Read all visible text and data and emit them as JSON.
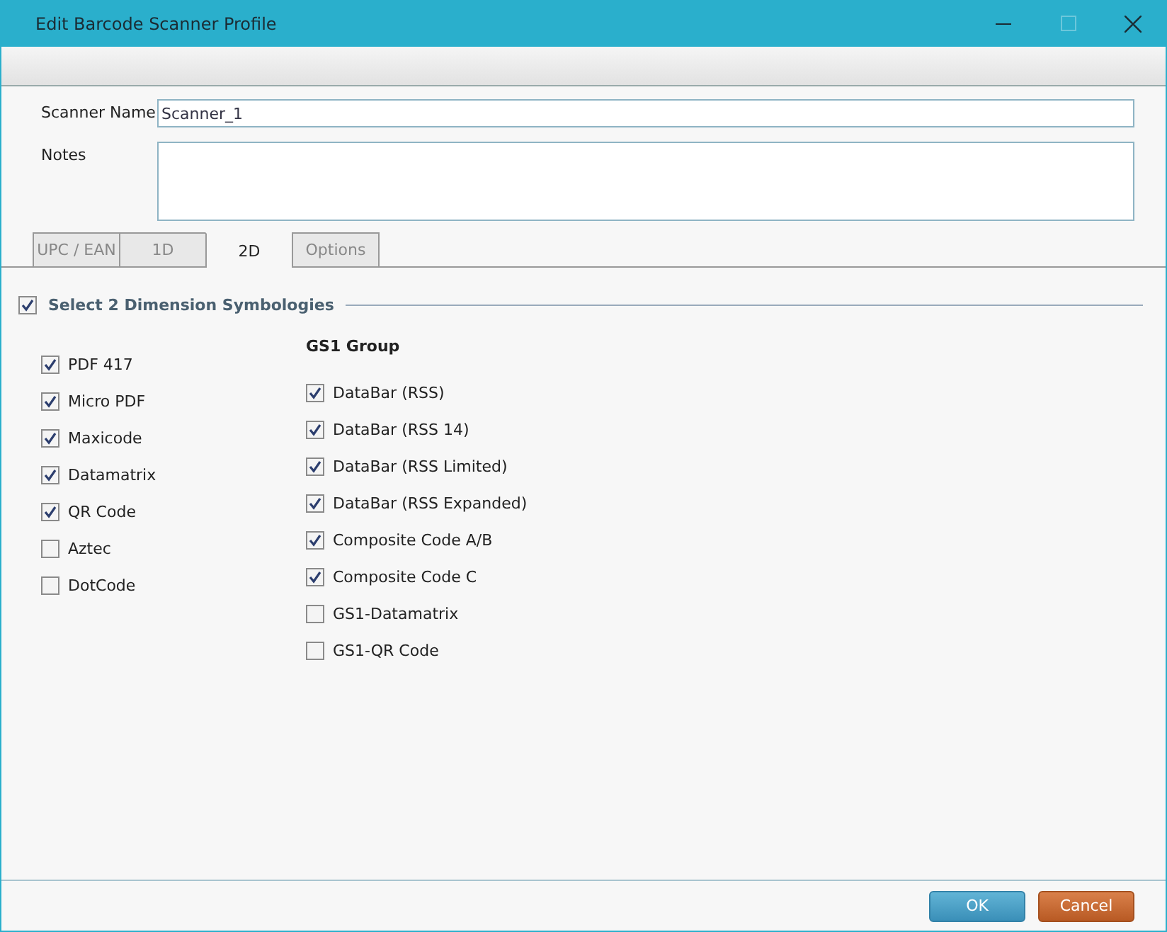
{
  "window": {
    "title": "Edit Barcode Scanner Profile"
  },
  "form": {
    "scanner_name": {
      "label": "Scanner Name",
      "value": "Scanner_1"
    },
    "notes": {
      "label": "Notes"
    }
  },
  "tabs": [
    {
      "label": "UPC / EAN",
      "selected": false
    },
    {
      "label": "1D",
      "selected": false
    },
    {
      "label": "2D",
      "selected": true
    },
    {
      "label": "Options",
      "selected": false
    }
  ],
  "group": {
    "label": "Select 2 Dimension Symbologies",
    "checked": true
  },
  "symbologies": [
    {
      "label": "PDF 417",
      "checked": true
    },
    {
      "label": "Micro PDF",
      "checked": true
    },
    {
      "label": "Maxicode",
      "checked": true
    },
    {
      "label": "Datamatrix",
      "checked": true
    },
    {
      "label": "QR Code",
      "checked": true
    },
    {
      "label": "Aztec",
      "checked": false
    },
    {
      "label": "DotCode",
      "checked": false
    }
  ],
  "gs1_group": {
    "title": "GS1 Group",
    "items": [
      {
        "label": "DataBar (RSS)",
        "checked": true
      },
      {
        "label": "DataBar (RSS 14)",
        "checked": true
      },
      {
        "label": "DataBar (RSS Limited)",
        "checked": true
      },
      {
        "label": "DataBar (RSS Expanded)",
        "checked": true
      },
      {
        "label": "Composite Code A/B",
        "checked": true
      },
      {
        "label": "Composite Code C",
        "checked": true
      },
      {
        "label": "GS1-Datamatrix",
        "checked": false
      },
      {
        "label": "GS1-QR Code",
        "checked": false
      }
    ]
  },
  "buttons": [
    {
      "label": "OK",
      "kind": "primary"
    },
    {
      "label": "Cancel",
      "kind": "cancel"
    }
  ]
}
